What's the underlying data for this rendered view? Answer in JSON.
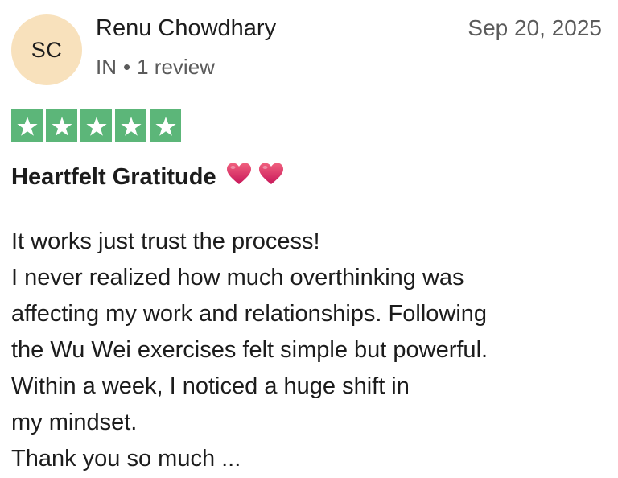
{
  "reviewer": {
    "initials": "SC",
    "name": "Renu Chowdhary",
    "country": "IN",
    "separator": "•",
    "review_count": "1 review",
    "avatar_color": "#f8e1bc"
  },
  "review": {
    "date": "Sep 20, 2025",
    "rating": 5,
    "rating_max": 5,
    "star_color": "#5cb679",
    "title": "Heartfelt Gratitude",
    "title_icons": [
      "heart-icon",
      "heart-icon"
    ],
    "body_lines": [
      "It works just trust the process!",
      "I never realized how much overthinking was",
      "affecting my work and relationships. Following",
      "the Wu Wei exercises felt simple but powerful.",
      "Within a week, I noticed a huge shift in",
      "my mindset.",
      "Thank you so much ..."
    ]
  }
}
